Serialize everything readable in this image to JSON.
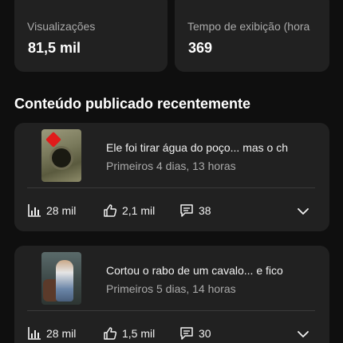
{
  "stats": {
    "views": {
      "label": "Visualizações",
      "value": "81,5 mil"
    },
    "watch_time": {
      "label": "Tempo de exibição (hora",
      "value": "369"
    }
  },
  "section": {
    "title": "Conteúdo publicado recentemente"
  },
  "videos": [
    {
      "title": "Ele foi tirar água do poço... mas o ch",
      "subtitle": "Primeiros 4 dias, 13 horas",
      "views": "28 mil",
      "likes": "2,1 mil",
      "comments": "38"
    },
    {
      "title": "Cortou o rabo de um cavalo... e fico",
      "subtitle": "Primeiros 5 dias, 14 horas",
      "views": "28 mil",
      "likes": "1,5 mil",
      "comments": "30"
    }
  ],
  "icons": {
    "views": "bar-chart-icon",
    "likes": "thumbs-up-icon",
    "comments": "comment-icon",
    "expand": "chevron-down-icon"
  },
  "colors": {
    "background": "#0f0f0f",
    "card": "#212121",
    "secondary_text": "#aaaaaa"
  }
}
